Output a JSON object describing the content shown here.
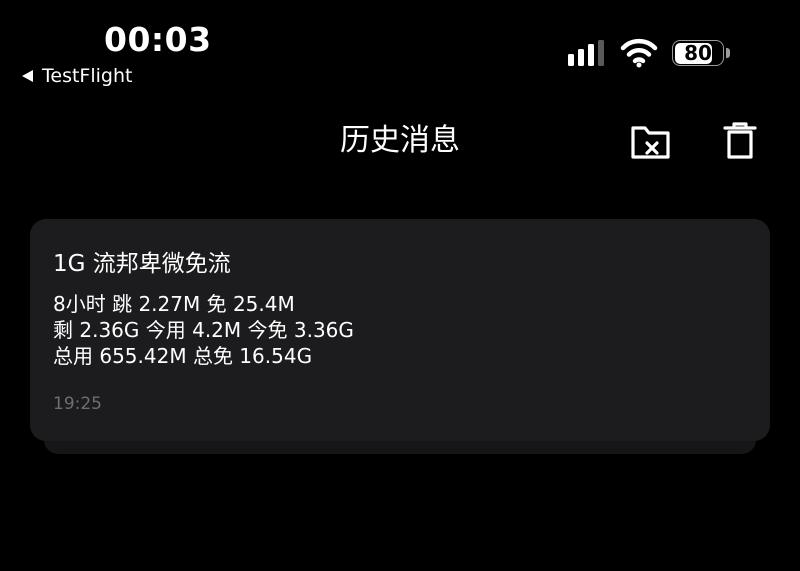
{
  "status_bar": {
    "time": "00:03",
    "back_app": "TestFlight",
    "battery_percent": 80,
    "battery_label": "80"
  },
  "header": {
    "title": "历史消息",
    "folder_action_icon": "folder-x-icon",
    "delete_action_icon": "trash-icon"
  },
  "messages": [
    {
      "title": "1G 流邦卑微免流",
      "lines": [
        "8小时 跳 2.27M 免 25.4M",
        "剩 2.36G 今用 4.2M 今免 3.36G",
        "总用 655.42M 总免 16.54G"
      ],
      "time": "19:25"
    }
  ],
  "colors": {
    "background": "#000000",
    "card": "#1c1c1e",
    "card_shadow": "#161616",
    "text": "#ffffff",
    "muted": "#6e6e73"
  }
}
